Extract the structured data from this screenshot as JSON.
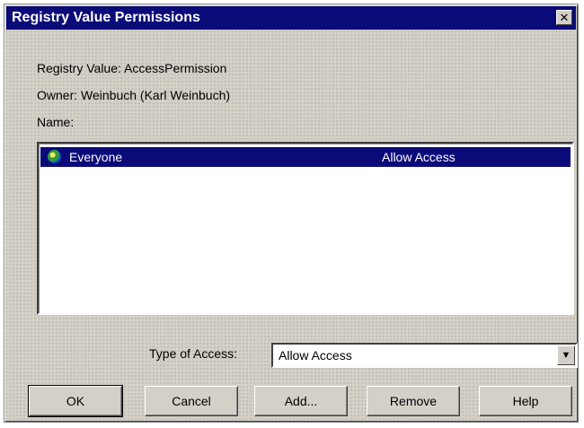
{
  "window": {
    "title": "Registry Value Permissions",
    "close_glyph": "✕"
  },
  "info": {
    "registry_value": "Registry Value:  AccessPermission",
    "owner": "Owner:  Weinbuch (Karl Weinbuch)",
    "name_label": "Name:"
  },
  "list": {
    "rows": [
      {
        "icon": "globe-icon",
        "name": "Everyone",
        "access": "Allow Access",
        "selected": true
      }
    ]
  },
  "type_of_access": {
    "label": "Type of Access:",
    "value": "Allow Access"
  },
  "buttons": {
    "ok": "OK",
    "cancel": "Cancel",
    "add": "Add...",
    "remove": "Remove",
    "help": "Help"
  },
  "colors": {
    "titlebar": "#0a0a78",
    "selection": "#0a0a78",
    "face": "#d4d0c8"
  }
}
